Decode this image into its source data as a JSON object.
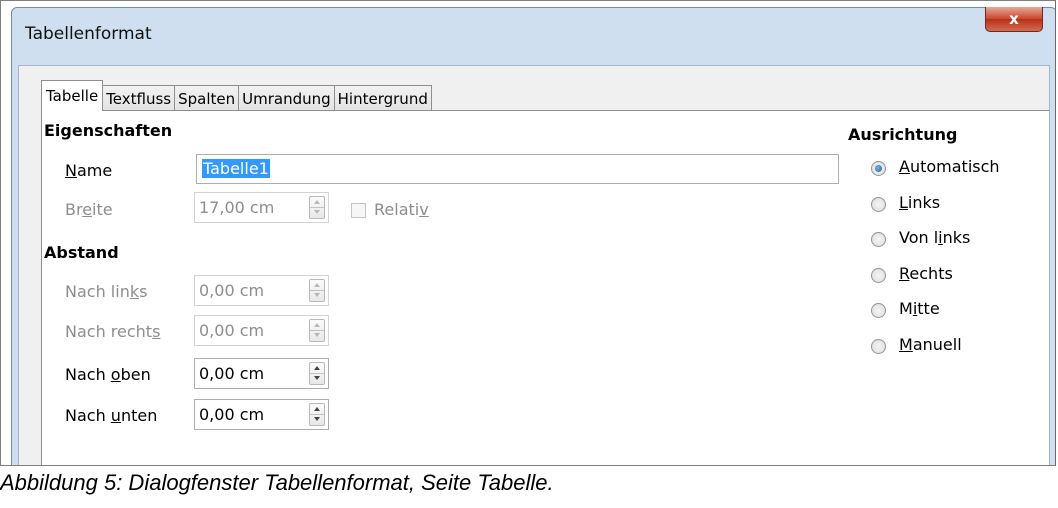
{
  "window": {
    "title": "Tabellenformat",
    "close_label": "x"
  },
  "tabs": [
    {
      "label": "Tabelle",
      "active": true
    },
    {
      "label": "Textfluss",
      "active": false
    },
    {
      "label": "Spalten",
      "active": false
    },
    {
      "label": "Umrandung",
      "active": false
    },
    {
      "label": "Hintergrund",
      "active": false
    }
  ],
  "eigenschaften": {
    "heading": "Eigenschaften",
    "name_label_pre": "",
    "name_label_ul": "N",
    "name_label_post": "ame",
    "name_value": "Tabelle1",
    "breite_label_pre": "Br",
    "breite_label_ul": "e",
    "breite_label_post": "ite",
    "breite_value": "17,00 cm",
    "relativ_label_pre": "Relati",
    "relativ_label_ul": "v",
    "relativ_label_post": ""
  },
  "abstand": {
    "heading": "Abstand",
    "links_label_pre": "Nach lin",
    "links_label_ul": "k",
    "links_label_post": "s",
    "links_value": "0,00 cm",
    "rechts_label_pre": "Nach recht",
    "rechts_label_ul": "s",
    "rechts_label_post": "",
    "rechts_value": "0,00 cm",
    "oben_label_pre": "Nach ",
    "oben_label_ul": "o",
    "oben_label_post": "ben",
    "oben_value": "0,00 cm",
    "unten_label_pre": "Nach ",
    "unten_label_ul": "u",
    "unten_label_post": "nten",
    "unten_value": "0,00 cm"
  },
  "ausrichtung": {
    "heading": "Ausrichtung",
    "options": [
      {
        "pre": "",
        "ul": "A",
        "post": "utomatisch",
        "checked": true
      },
      {
        "pre": "",
        "ul": "L",
        "post": "inks",
        "checked": false
      },
      {
        "pre": "Von l",
        "ul": "i",
        "post": "nks",
        "checked": false
      },
      {
        "pre": "",
        "ul": "R",
        "post": "echts",
        "checked": false
      },
      {
        "pre": "M",
        "ul": "i",
        "post": "tte",
        "checked": false
      },
      {
        "pre": "",
        "ul": "M",
        "post": "anuell",
        "checked": false
      }
    ]
  },
  "caption": "Abbildung 5: Dialogfenster Tabellenformat, Seite Tabelle."
}
